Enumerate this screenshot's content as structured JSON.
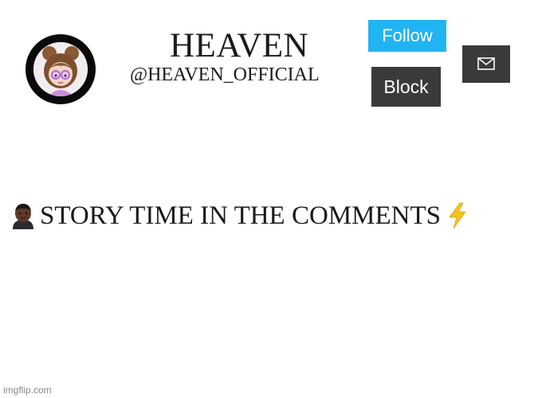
{
  "profile": {
    "display_name": "HEAVEN",
    "handle": "@HEAVEN_OFFICIAL"
  },
  "actions": {
    "follow_label": "Follow",
    "block_label": "Block",
    "message_icon": "mail-icon"
  },
  "post": {
    "leading_icon": "person-emoji-icon",
    "text": "STORY TIME IN THE COMMENTS",
    "trailing_icon": "lightning-bolt-icon"
  },
  "watermark": {
    "text": "imgflip.com"
  },
  "colors": {
    "follow_button": "#21b4f2",
    "dark_button": "#3a3a3c",
    "avatar_ring": "#0a0a0a",
    "bolt": "#f6c21b"
  }
}
